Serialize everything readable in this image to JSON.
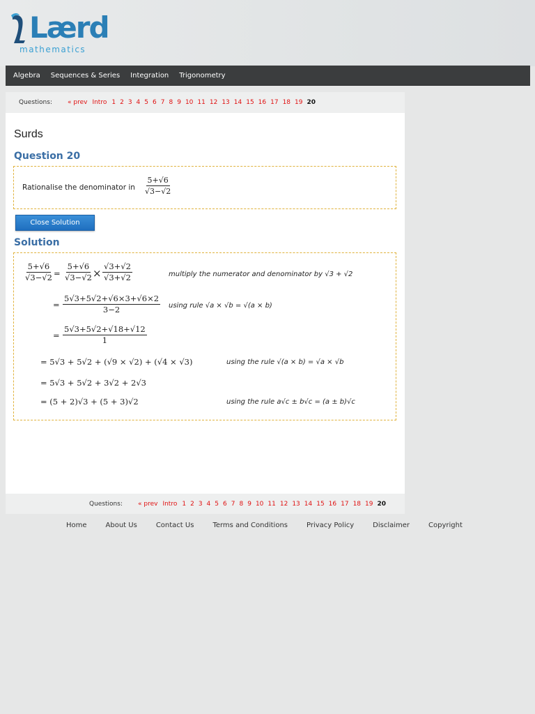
{
  "logo": {
    "word": "Lærd",
    "sub": "mathematics"
  },
  "nav": {
    "items": [
      "Algebra",
      "Sequences & Series",
      "Integration",
      "Trigonometry"
    ]
  },
  "pager": {
    "label": "Questions:",
    "prev": "« prev",
    "intro": "Intro",
    "pages": [
      "1",
      "2",
      "3",
      "4",
      "5",
      "6",
      "7",
      "8",
      "9",
      "10",
      "11",
      "12",
      "13",
      "14",
      "15",
      "16",
      "17",
      "18",
      "19"
    ],
    "current": "20"
  },
  "page": {
    "title": "Surds",
    "question_heading": "Question 20",
    "question_text": "Rationalise the denominator in",
    "question_frac_num": "5+√6",
    "question_frac_den": "√3−√2",
    "close_button": "Close Solution",
    "solution_heading": "Solution"
  },
  "solution": {
    "line1_left_num": "5+√6",
    "line1_left_den": "√3−√2",
    "line1_eq": "=",
    "line1_mid_num": "5+√6",
    "line1_mid_den": "√3−√2",
    "line1_times": "×",
    "line1_right_num": "√3+√2",
    "line1_right_den": "√3+√2",
    "line1_note": "multiply the numerator and denominator by √3 + √2",
    "line2_num": "5√3+5√2+√6×3+√6×2",
    "line2_den": "3−2",
    "line2_note": "using rule  √a × √b = √(a × b)",
    "line3_num": "5√3+5√2+√18+√12",
    "line3_den": "1",
    "line4": "= 5√3 + 5√2 + (√9 × √2) + (√4 × √3)",
    "line4_note": "using the rule √(a × b) = √a × √b",
    "line5": "= 5√3 + 5√2 + 3√2 + 2√3",
    "line6": "= (5 + 2)√3 + (5 + 3)√2",
    "line6_note": "using the rule a√c ± b√c = (a ± b)√c"
  },
  "footer": {
    "links": [
      "Home",
      "About Us",
      "Contact Us",
      "Terms and Conditions",
      "Privacy Policy",
      "Disclaimer",
      "Copyright"
    ]
  },
  "colors": {
    "nav_bg": "#3b3d3e",
    "heading_blue": "#3a6ea5",
    "pager_red": "#e01010",
    "box_border": "#e0b23c",
    "button_blue": "#1f6fbf"
  }
}
